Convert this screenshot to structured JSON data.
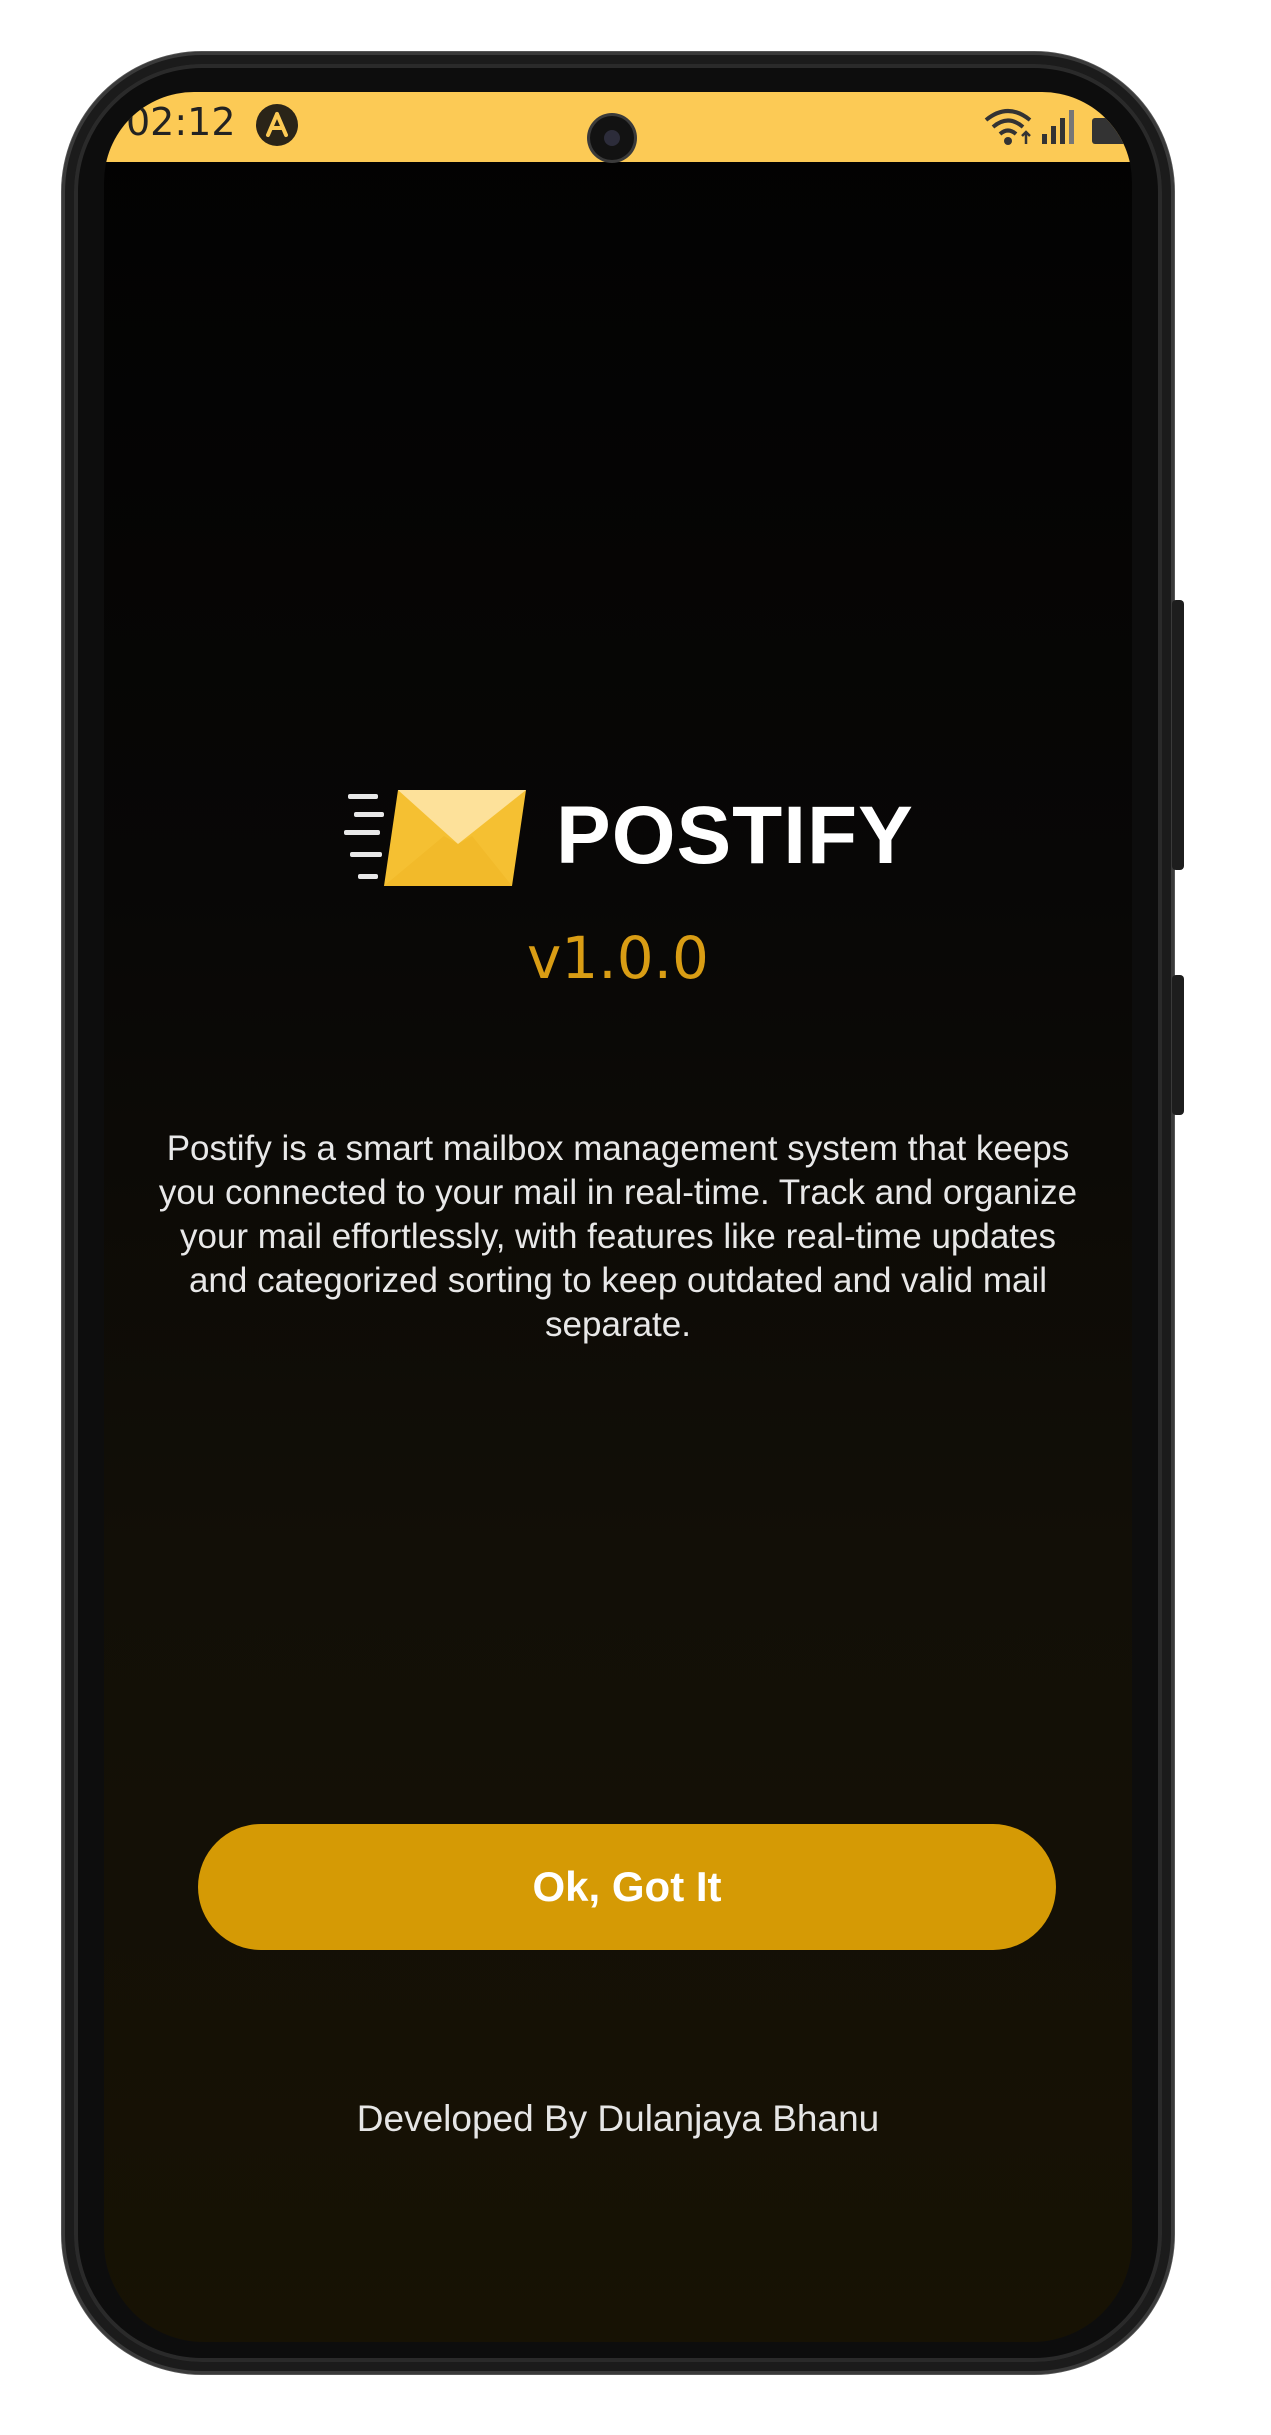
{
  "status_bar": {
    "time": "02:12",
    "background_color": "#fcca55",
    "app_icon": "expo-icon",
    "icons": [
      "wifi-icon",
      "signal-icon",
      "battery-icon"
    ]
  },
  "app": {
    "logo_icon": "envelope-icon",
    "name": "POSTIFY",
    "version": "v1.0.0",
    "description": "Postify is a smart mailbox management system that keeps you connected to your mail in real-time. Track and organize your mail effortlessly, with features like real-time updates and categorized sorting to keep outdated and valid mail separate.",
    "accent_color": "#d59a05"
  },
  "actions": {
    "ok_label": "Ok, Got It"
  },
  "footer": {
    "credit": "Developed By Dulanjaya Bhanu"
  }
}
